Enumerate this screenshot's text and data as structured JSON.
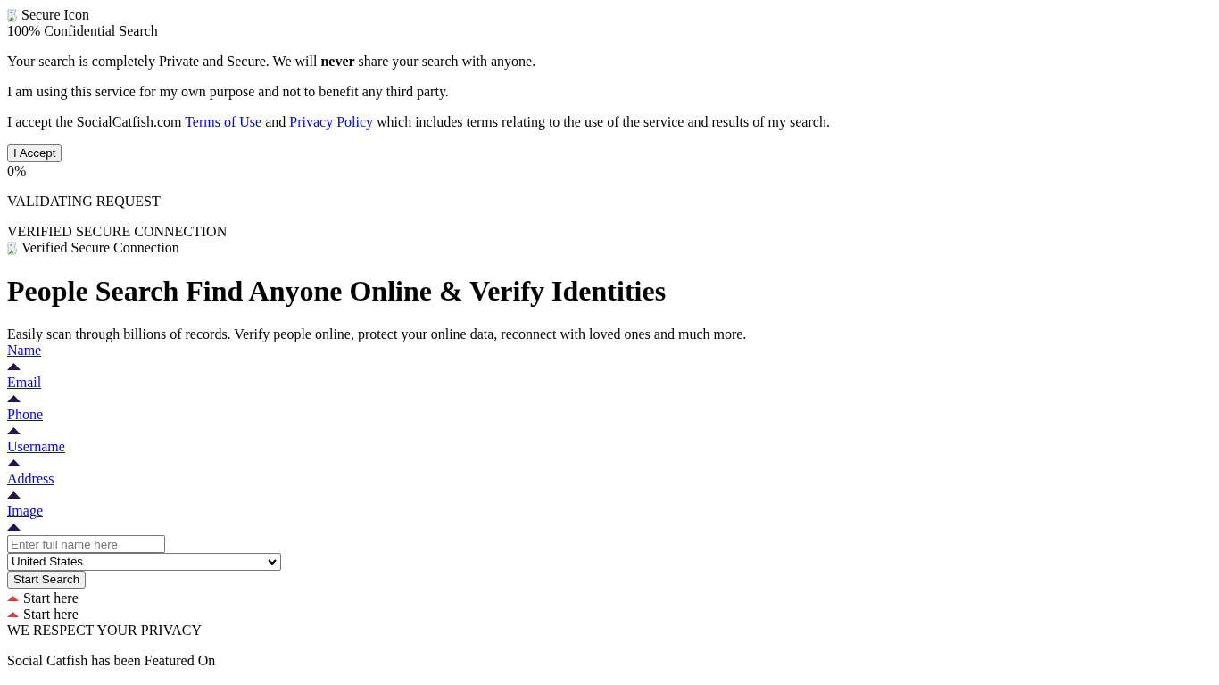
{
  "consent": {
    "icon_alt": "Secure Icon",
    "title": "100% Confidential Search",
    "paragraphs": [
      "Your search is completely Private and Secure. We will **never** share your search with anyone.",
      "I am using this service for my own purpose and not to benefit any third party."
    ],
    "terms": {
      "before": "I accept the SocialCatfish.com",
      "link1": "Terms of Use",
      "middle": "and",
      "link2": "Privacy Policy",
      "after": "which includes terms relating to the use of the service and results of my search."
    },
    "accept_button": "I Accept"
  },
  "progress": {
    "percent": "0%",
    "status": "VALIDATING REQUEST",
    "secure_label": "VERIFIED SECURE CONNECTION",
    "badge_alt": "Verified Secure Connection"
  },
  "hero": {
    "heading": "People Search Find Anyone Online & Verify Identities",
    "subheading": "Easily scan through billions of records. Verify people online, protect your online data, reconnect with loved ones and much more."
  },
  "search_tabs": [
    {
      "label": "Name"
    },
    {
      "label": "Email"
    },
    {
      "label": "Phone"
    },
    {
      "label": "Username"
    },
    {
      "label": "Address"
    },
    {
      "label": "Image"
    }
  ],
  "search_form": {
    "placeholder": "Enter full name here",
    "country": "United States",
    "button": "Start Search",
    "hints": [
      "Start here",
      "Start here"
    ]
  },
  "footer": {
    "privacy": "WE RESPECT YOUR PRIVACY",
    "featured": "Social Catfish has been Featured On"
  }
}
